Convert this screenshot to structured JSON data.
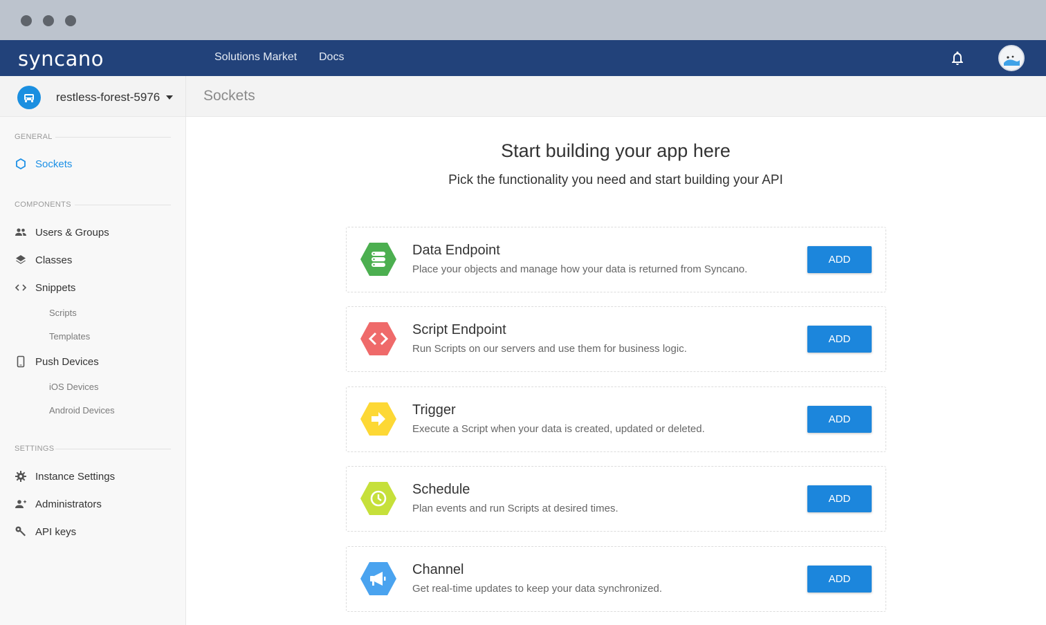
{
  "app": {
    "logo_text": "syncano",
    "nav": [
      "Solutions Market",
      "Docs"
    ],
    "icons": {
      "notifications": "bell-icon",
      "user": "avatar"
    }
  },
  "instance": {
    "name": "restless-forest-5976",
    "icon": "car-icon",
    "color": "#1b8fe0"
  },
  "page_title": "Sockets",
  "sidebar": {
    "sections": [
      {
        "label": "GENERAL"
      },
      {
        "label": "COMPONENTS"
      },
      {
        "label": "SETTINGS"
      }
    ],
    "items": [
      {
        "label": "Sockets",
        "icon": "hexagon-icon",
        "active": true
      },
      {
        "label": "Users & Groups",
        "icon": "users-icon"
      },
      {
        "label": "Classes",
        "icon": "layers-icon"
      },
      {
        "label": "Snippets",
        "icon": "code-icon"
      },
      {
        "label": "Scripts",
        "sub": true
      },
      {
        "label": "Templates",
        "sub": true
      },
      {
        "label": "Push Devices",
        "icon": "phone-icon"
      },
      {
        "label": "iOS Devices",
        "sub": true
      },
      {
        "label": "Android Devices",
        "sub": true
      },
      {
        "label": "Instance Settings",
        "icon": "gear-icon"
      },
      {
        "label": "Administrators",
        "icon": "add-person-icon"
      },
      {
        "label": "API keys",
        "icon": "key-icon"
      }
    ]
  },
  "main": {
    "title": "Start building your app here",
    "subtitle": "Pick the functionality you need and start building your API",
    "sockets": [
      {
        "title": "Data Endpoint",
        "description": "Place your objects and manage how your data is returned from Syncano.",
        "icon": "database-icon",
        "color": "#4caf50",
        "button": "ADD"
      },
      {
        "title": "Script Endpoint",
        "description": "Run Scripts on our servers and use them for business logic.",
        "icon": "code-icon",
        "color": "#ef6a6a",
        "button": "ADD"
      },
      {
        "title": "Trigger",
        "description": "Execute a Script when your data is created, updated or deleted.",
        "icon": "arrow-right-icon",
        "color": "#fdd835",
        "button": "ADD"
      },
      {
        "title": "Schedule",
        "description": "Plan events and run Scripts at desired times.",
        "icon": "clock-icon",
        "color": "#c6e03a",
        "button": "ADD"
      },
      {
        "title": "Channel",
        "description": "Get real-time updates to keep your data synchronized.",
        "icon": "megaphone-icon",
        "color": "#4aa3ef",
        "button": "ADD"
      }
    ]
  },
  "colors": {
    "topbar": "#22427a",
    "accent": "#1c86dc",
    "active_nav": "#1c90e6"
  }
}
